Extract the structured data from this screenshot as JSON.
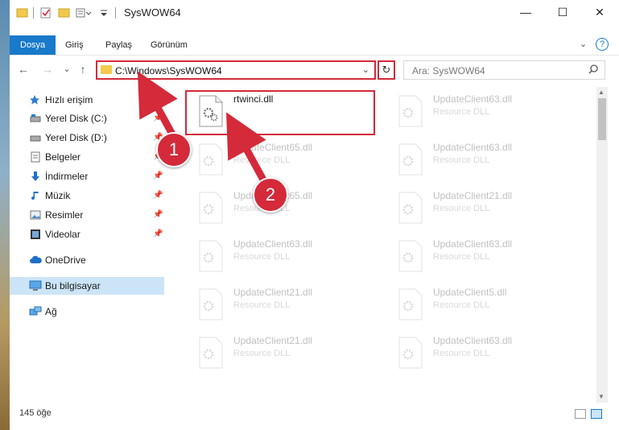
{
  "window": {
    "title": "SysWOW64",
    "minimize": "—",
    "maximize": "☐",
    "close": "✕"
  },
  "ribbon": {
    "tabs": [
      "Dosya",
      "Giriş",
      "Paylaş",
      "Görünüm"
    ],
    "expand": "⌄",
    "help": "?"
  },
  "nav": {
    "back": "←",
    "forward": "→",
    "recent": "⌄",
    "up": "↑"
  },
  "address": {
    "path": "C:\\Windows\\SysWOW64",
    "dropdown": "⌄",
    "refresh": "↻"
  },
  "search": {
    "placeholder": "Ara: SysWOW64",
    "icon": "search-icon"
  },
  "navpane": {
    "items": [
      {
        "label": "Hızlı erişim",
        "icon": "star-icon",
        "pinned": false
      },
      {
        "label": "Yerel Disk (C:)",
        "icon": "drive-icon",
        "pinned": true
      },
      {
        "label": "Yerel Disk (D:)",
        "icon": "drive-icon",
        "pinned": true
      },
      {
        "label": "Belgeler",
        "icon": "documents-icon",
        "pinned": true
      },
      {
        "label": "İndirmeler",
        "icon": "download-icon",
        "pinned": true
      },
      {
        "label": "Müzik",
        "icon": "music-icon",
        "pinned": true
      },
      {
        "label": "Resimler",
        "icon": "pictures-icon",
        "pinned": true
      },
      {
        "label": "Videolar",
        "icon": "video-icon",
        "pinned": true
      },
      {
        "label": "OneDrive",
        "icon": "cloud-icon",
        "pinned": false
      },
      {
        "label": "Bu bilgisayar",
        "icon": "computer-icon",
        "pinned": false
      },
      {
        "label": "Ağ",
        "icon": "network-icon",
        "pinned": false
      }
    ],
    "pin_glyph": "📌"
  },
  "files": [
    {
      "name": "rtwinci.dll",
      "type": "",
      "highlighted": true
    },
    {
      "name": "UpdateClient63.dll",
      "type": "Resource DLL"
    },
    {
      "name": "UpdateClient65.dll",
      "type": "Resource DLL"
    },
    {
      "name": "UpdateClient63.dll",
      "type": "Resource DLL"
    },
    {
      "name": "UpdateClient65.dll",
      "type": "Resource DLL"
    },
    {
      "name": "UpdateClient21.dll",
      "type": "Resource DLL"
    },
    {
      "name": "UpdateClient63.dll",
      "type": "Resource DLL"
    },
    {
      "name": "UpdateClient63.dll",
      "type": "Resource DLL"
    },
    {
      "name": "UpdateClient21.dll",
      "type": "Resource DLL"
    },
    {
      "name": "UpdateClient5.dll",
      "type": "Resource DLL"
    },
    {
      "name": "UpdateClient21.dll",
      "type": "Resource DLL"
    },
    {
      "name": "UpdateClient63.dll",
      "type": "Resource DLL"
    }
  ],
  "status": {
    "count": "145 öğe"
  },
  "annotations": {
    "badge1": "1",
    "badge2": "2"
  },
  "colors": {
    "accent": "#1979ca",
    "annotation": "#d42a3a",
    "selected": "#cce4f7"
  }
}
